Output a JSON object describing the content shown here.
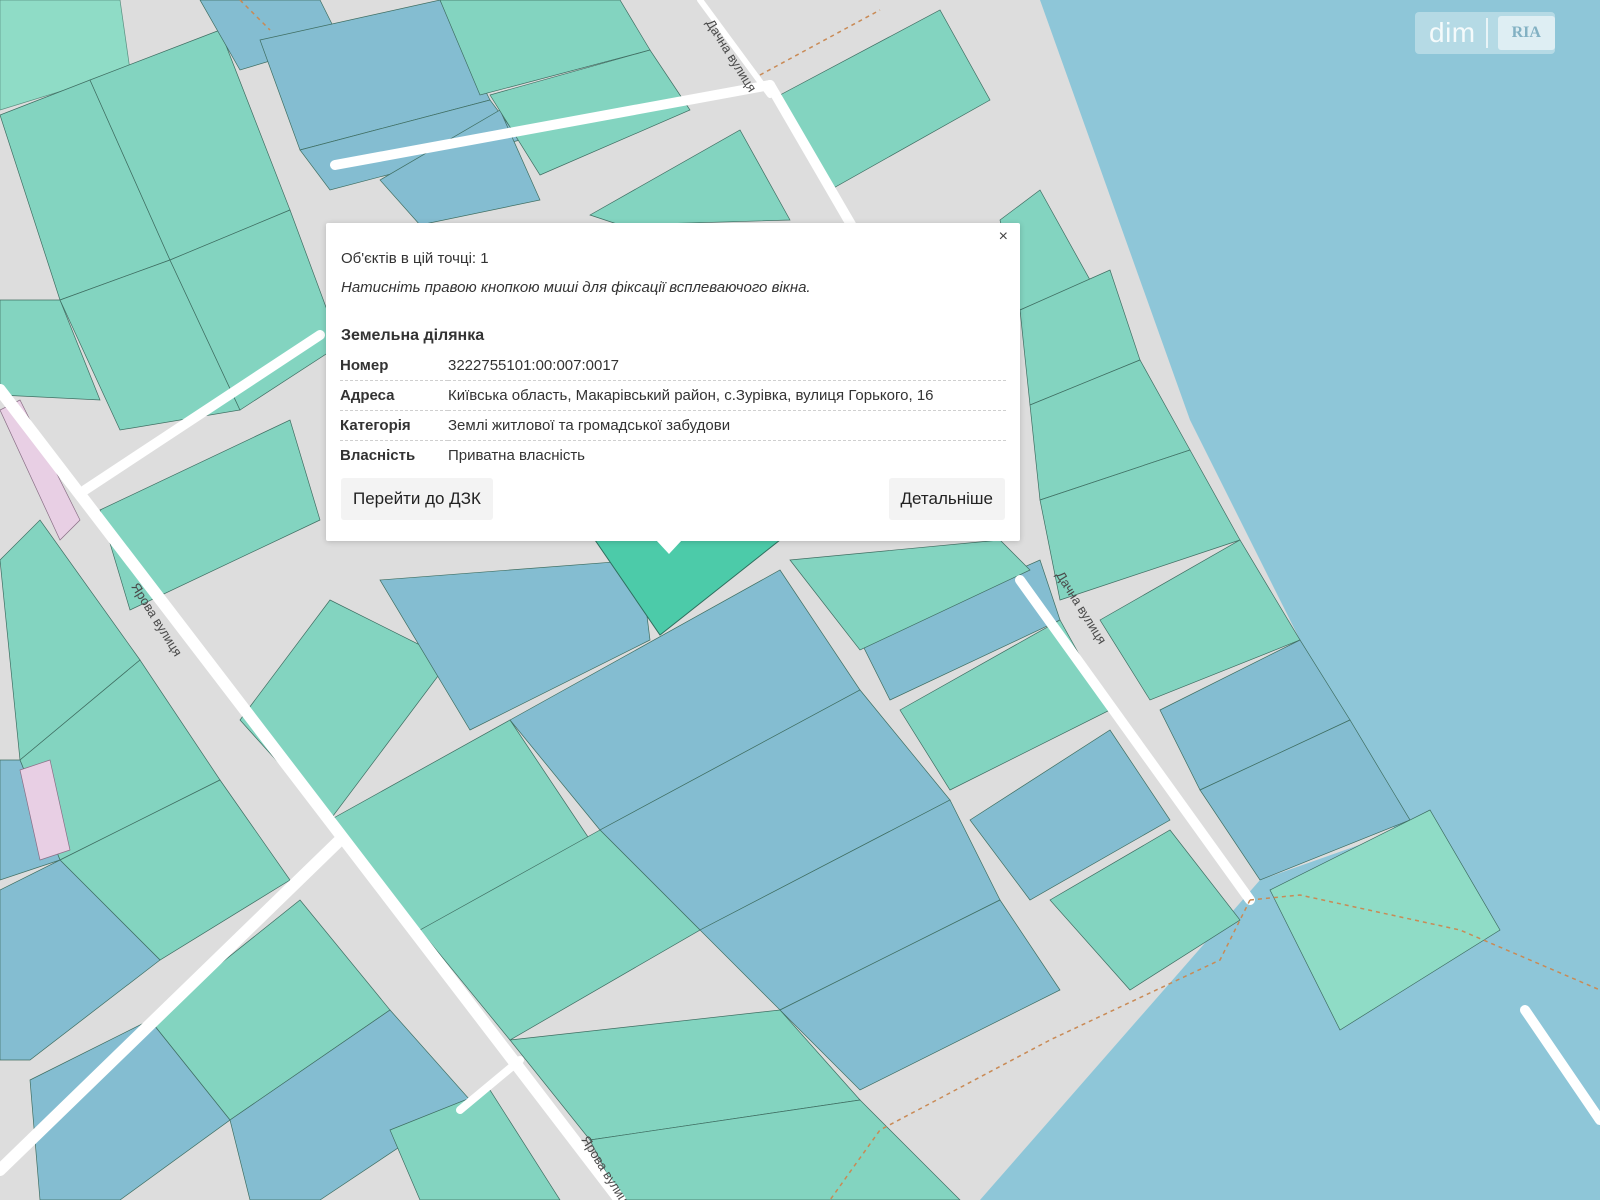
{
  "map": {
    "colors": {
      "background": "#dddddd",
      "parcel_green": "#83d4c0",
      "parcel_blue": "#84bdd1",
      "water": "#8ec6d8",
      "selected": "#4ccba9",
      "pink": "#e8cfe4",
      "road": "#ffffff"
    },
    "street_labels": {
      "s1": "Дачна вулиця",
      "s2": "Ярова вулиця",
      "s3": "Дачна вулиця",
      "s4": "Ярова вулиця"
    }
  },
  "logo": {
    "text": "dim",
    "badge": "RIA"
  },
  "popup": {
    "close_label": "×",
    "objects_count": "Об'єктів в цій точці: 1",
    "hint": "Натисніть правою кнопкою миші для фіксації всплеваючого вікна.",
    "heading": "Земельна ділянка",
    "rows": [
      {
        "key": "Номер",
        "value": "3222755101:00:007:0017"
      },
      {
        "key": "Адреса",
        "value": "Київська область, Макарівський район, с.Зурівка, вулиця Горького, 16"
      },
      {
        "key": "Категорія",
        "value": "Землі житлової та громадської забудови"
      },
      {
        "key": "Власність",
        "value": "Приватна власність"
      }
    ],
    "btn_dzk": "Перейти до ДЗК",
    "btn_details": "Детальніше"
  }
}
